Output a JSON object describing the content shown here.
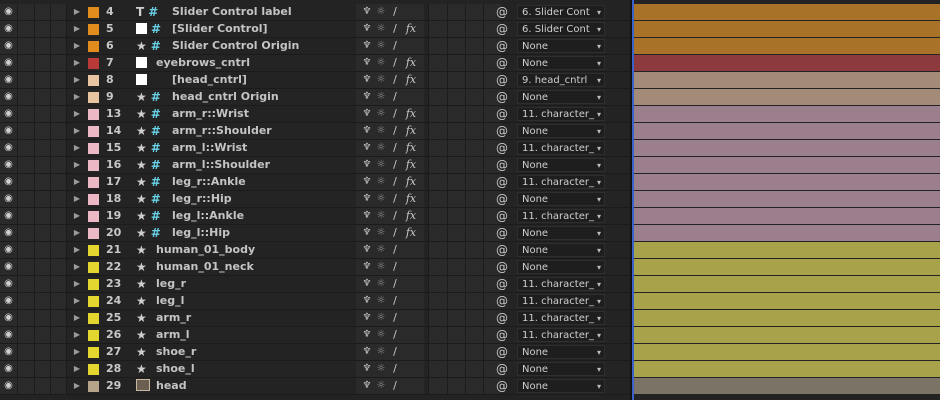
{
  "layers": [
    {
      "num": "4",
      "type": "text",
      "name": "Slider Control label",
      "color": "#e08d1e",
      "fx": false,
      "sw2": true,
      "parent": "6. Slider Cont",
      "bar": "#a87328"
    },
    {
      "num": "5",
      "type": "solid",
      "name": "[Slider Control]",
      "color": "#e08d1e",
      "fx": true,
      "sw2": true,
      "parent": "6. Slider Cont",
      "bar": "#a87328"
    },
    {
      "num": "6",
      "type": "star",
      "name": "Slider Control Origin",
      "color": "#e08d1e",
      "fx": false,
      "sw2": true,
      "parent": "None",
      "bar": "#a87328"
    },
    {
      "num": "7",
      "type": "solid-only",
      "name": "eyebrows_cntrl",
      "color": "#b93838",
      "fx": true,
      "sw2": false,
      "parent": "None",
      "bar": "#8c3a3e"
    },
    {
      "num": "8",
      "type": "solid-only",
      "name": "[head_cntrl]",
      "color": "#e9c4a1",
      "fx": true,
      "sw2": false,
      "parent": "9. head_cntrl",
      "bar": "#a38b78"
    },
    {
      "num": "9",
      "type": "star",
      "name": "head_cntrl Origin",
      "color": "#e9c4a1",
      "fx": false,
      "sw2": true,
      "parent": "None",
      "bar": "#a38b78"
    },
    {
      "num": "13",
      "type": "star",
      "name": "arm_r::Wrist",
      "color": "#ecb8c6",
      "fx": true,
      "sw2": false,
      "parent": "11. character_",
      "bar": "#9b7f8c"
    },
    {
      "num": "14",
      "type": "star",
      "name": "arm_r::Shoulder",
      "color": "#ecb8c6",
      "fx": true,
      "sw2": false,
      "parent": "None",
      "bar": "#9b7f8c"
    },
    {
      "num": "15",
      "type": "star",
      "name": "arm_l::Wrist",
      "color": "#ecb8c6",
      "fx": true,
      "sw2": false,
      "parent": "11. character_",
      "bar": "#9b7f8c"
    },
    {
      "num": "16",
      "type": "star",
      "name": "arm_l::Shoulder",
      "color": "#ecb8c6",
      "fx": true,
      "sw2": false,
      "parent": "None",
      "bar": "#9b7f8c"
    },
    {
      "num": "17",
      "type": "star",
      "name": "leg_r::Ankle",
      "color": "#ecb8c6",
      "fx": true,
      "sw2": false,
      "parent": "11. character_",
      "bar": "#9b7f8c"
    },
    {
      "num": "18",
      "type": "star",
      "name": "leg_r::Hip",
      "color": "#ecb8c6",
      "fx": true,
      "sw2": false,
      "parent": "None",
      "bar": "#9b7f8c"
    },
    {
      "num": "19",
      "type": "star",
      "name": "leg_l::Ankle",
      "color": "#ecb8c6",
      "fx": true,
      "sw2": false,
      "parent": "11. character_",
      "bar": "#9b7f8c"
    },
    {
      "num": "20",
      "type": "star",
      "name": "leg_l::Hip",
      "color": "#ecb8c6",
      "fx": true,
      "sw2": false,
      "parent": "None",
      "bar": "#9b7f8c"
    },
    {
      "num": "21",
      "type": "star-only",
      "name": "human_01_body",
      "color": "#e3d62e",
      "fx": false,
      "sw2": true,
      "parent": "None",
      "bar": "#a8a24a"
    },
    {
      "num": "22",
      "type": "star-only",
      "name": "human_01_neck",
      "color": "#e3d62e",
      "fx": false,
      "sw2": true,
      "parent": "None",
      "bar": "#a8a24a"
    },
    {
      "num": "23",
      "type": "star-only",
      "name": "leg_r",
      "color": "#e3d62e",
      "fx": false,
      "sw2": true,
      "parent": "11. character_",
      "bar": "#a8a24a"
    },
    {
      "num": "24",
      "type": "star-only",
      "name": "leg_l",
      "color": "#e3d62e",
      "fx": false,
      "sw2": true,
      "parent": "11. character_",
      "bar": "#a8a24a"
    },
    {
      "num": "25",
      "type": "star-only",
      "name": "arm_r",
      "color": "#e3d62e",
      "fx": false,
      "sw2": true,
      "parent": "11. character_",
      "bar": "#a8a24a"
    },
    {
      "num": "26",
      "type": "star-only",
      "name": "arm_l",
      "color": "#e3d62e",
      "fx": false,
      "sw2": true,
      "parent": "11. character_",
      "bar": "#a8a24a"
    },
    {
      "num": "27",
      "type": "star-only",
      "name": "shoe_r",
      "color": "#e3d62e",
      "fx": false,
      "sw2": true,
      "parent": "None",
      "bar": "#a8a24a"
    },
    {
      "num": "28",
      "type": "star-only",
      "name": "shoe_l",
      "color": "#e3d62e",
      "fx": false,
      "sw2": true,
      "parent": "None",
      "bar": "#a8a24a"
    },
    {
      "num": "29",
      "type": "image",
      "name": "head",
      "color": "#b5a48a",
      "fx": false,
      "sw2": true,
      "parent": "None",
      "bar": "#7c7367"
    }
  ],
  "icons": {
    "eye": "◉",
    "twirl": "▶",
    "star": "★",
    "grid": "#",
    "shy": "♆",
    "collapse": "☼",
    "quality": "/",
    "fx": "fx",
    "pickwhip": "@",
    "dropdown": "▾"
  }
}
